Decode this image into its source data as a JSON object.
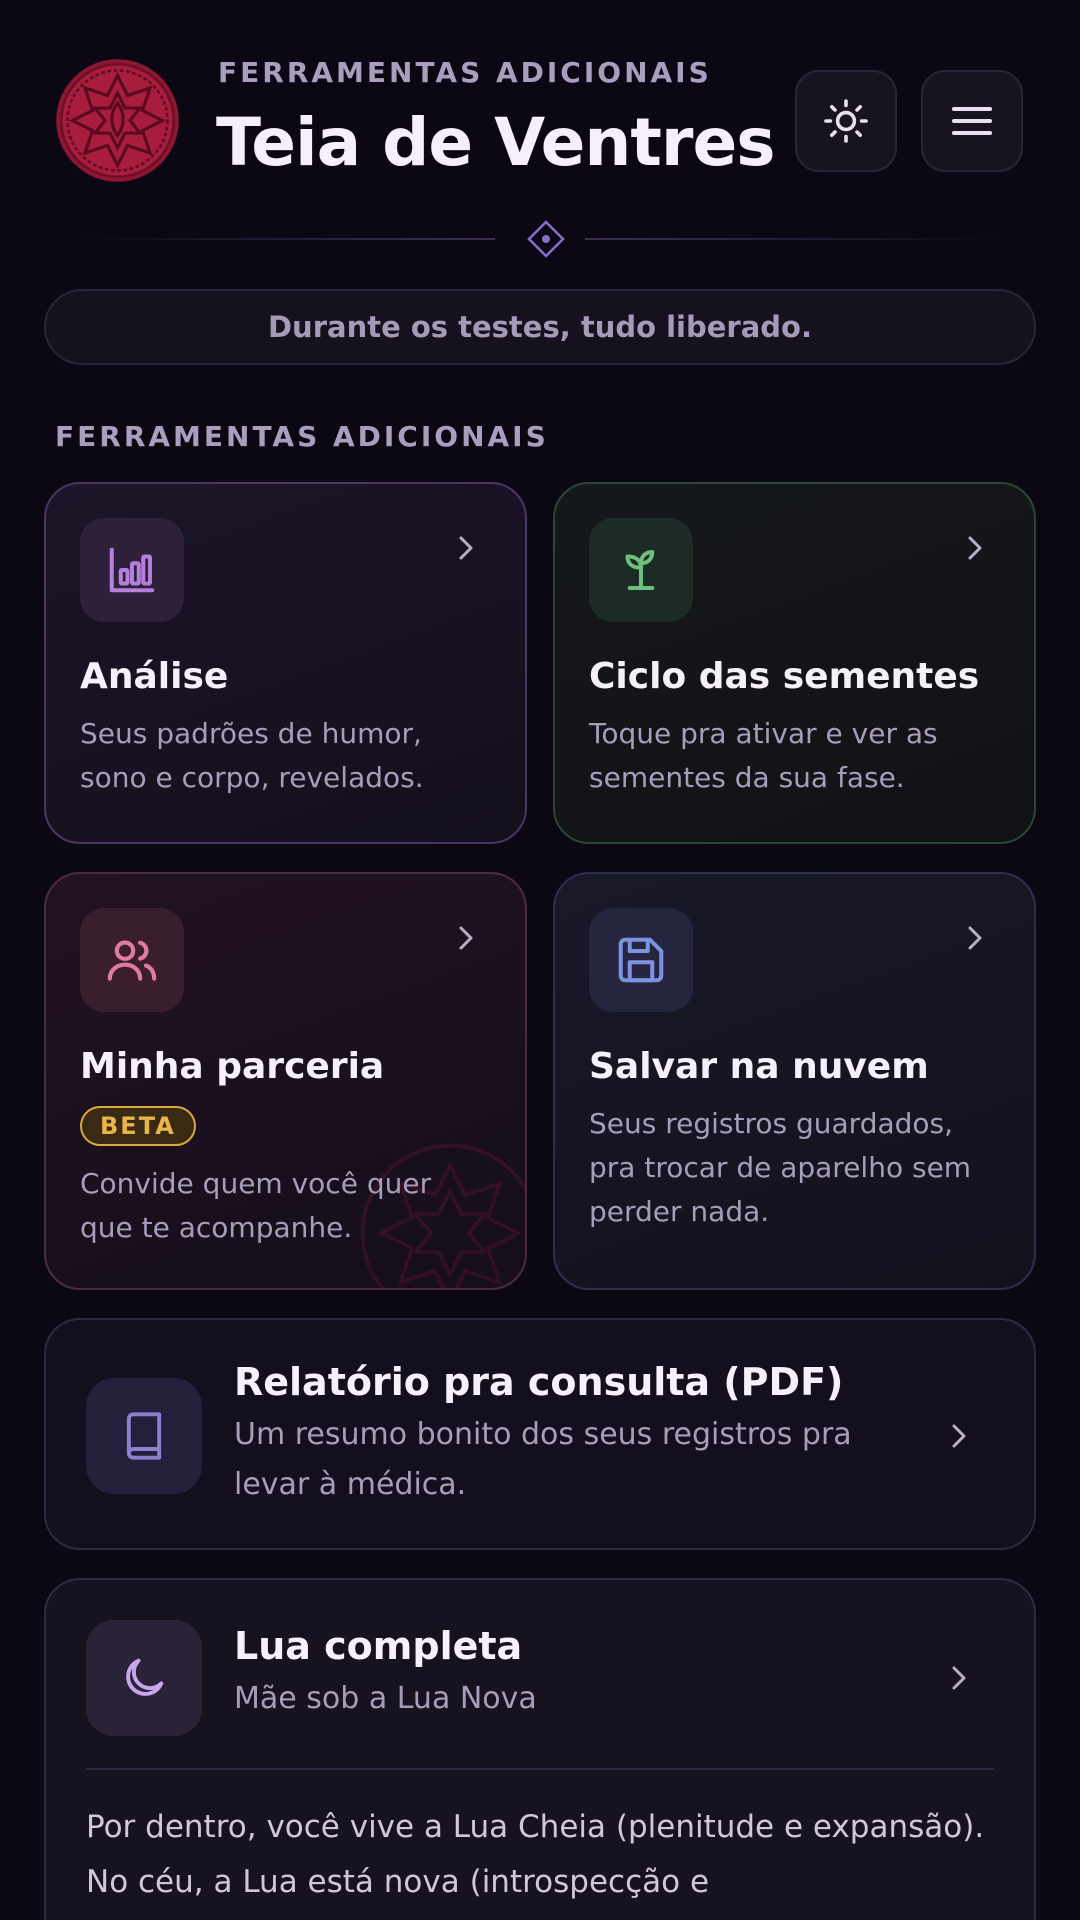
{
  "header": {
    "eyebrow": "FERRAMENTAS ADICIONAIS",
    "title": "Teia de Ventres",
    "logo_icon": "mandala-logo-icon",
    "theme_icon": "sun-icon",
    "menu_icon": "hamburger-menu-icon"
  },
  "banner": {
    "text": "Durante os testes, tudo liberado."
  },
  "section": {
    "title": "FERRAMENTAS ADICIONAIS"
  },
  "cards": {
    "analise": {
      "title": "Análise",
      "desc": "Seus padrões de humor, sono e corpo, revelados.",
      "icon": "bar-chart-icon",
      "accent": "#b480dc"
    },
    "ciclo": {
      "title": "Ciclo das sementes",
      "desc": "Toque pra ativar e ver as sementes da sua fase.",
      "icon": "sprout-icon",
      "accent": "#6fbf7e"
    },
    "parceria": {
      "title": "Minha parceria",
      "badge": "BETA",
      "desc": "Convide quem você quer que te acompanhe.",
      "icon": "users-icon",
      "accent": "#e07aa2"
    },
    "nuvem": {
      "title": "Salvar na nuvem",
      "desc": "Seus registros guardados, pra trocar de aparelho sem perder nada.",
      "icon": "save-icon",
      "accent": "#7d92e0"
    }
  },
  "relatorio": {
    "title": "Relatório pra consulta (PDF)",
    "desc": "Um resumo bonito dos seus registros pra levar à médica.",
    "icon": "book-icon"
  },
  "lua": {
    "title": "Lua completa",
    "subtitle": "Mãe sob a Lua Nova",
    "icon": "moon-icon",
    "body": "Por dentro, você vive a Lua Cheia (plenitude e expansão). No céu, a Lua está nova (introspecção e"
  }
}
